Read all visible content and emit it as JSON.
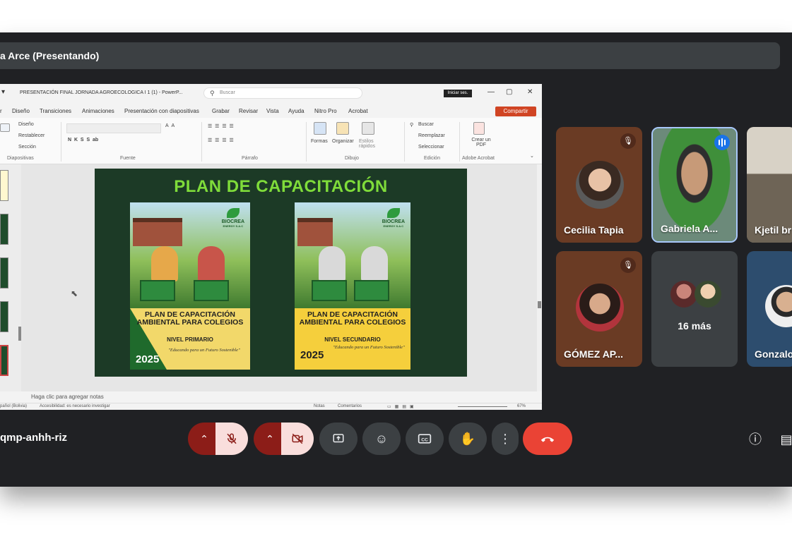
{
  "meeting": {
    "presenter_title": "a Arce (Presentando)",
    "meeting_code": "qmp-anhh-riz"
  },
  "ppt": {
    "filename": "PRESENTACIÓN FINAL JORNADA AGROECOLOGICA I 1 (1) - PowerP...",
    "search_placeholder": "Buscar",
    "account": "Iniciar ses.",
    "menu": [
      "Diseño",
      "Transiciones",
      "Animaciones",
      "Presentación con diapositivas",
      "Grabar",
      "Revisar",
      "Vista",
      "Ayuda",
      "Nitro Pro",
      "Acrobat"
    ],
    "share_label": "Compartir",
    "ribbon": {
      "slides_items": [
        "Diseño",
        "Restablecer",
        "Sección"
      ],
      "slides_group": "Diapositivas",
      "font_group": "Fuente",
      "paragraph_group": "Párrafo",
      "drawing_group": "Dibujo",
      "drawing_items": [
        "Formas",
        "Organizar",
        "Estilos rápidos"
      ],
      "editing_group": "Edición",
      "editing_items": [
        "Buscar",
        "Reemplazar",
        "Seleccionar"
      ],
      "acrobat_group": "Adobe Acrobat",
      "acrobat_item": "Crear un PDF"
    },
    "slide": {
      "title": "PLAN DE CAPACITACIÓN",
      "covers": [
        {
          "brand": "BIOCREA",
          "brand_sub": "ENERGY S.A.C",
          "heading": "PLAN DE CAPACITACIÓN AMBIENTAL PARA COLEGIOS",
          "level": "NIVEL PRIMARIO",
          "tagline": "\"Educando para un Futuro Sostenible\"",
          "year": "2025"
        },
        {
          "brand": "BIOCREA",
          "brand_sub": "ENERGY S.A.C",
          "heading": "PLAN DE CAPACITACIÓN AMBIENTAL PARA COLEGIOS",
          "level": "NIVEL SECUNDARIO",
          "tagline": "\"Educando para un Futuro Sostenible\"",
          "year": "2025"
        }
      ]
    },
    "notes_placeholder": "Haga clic para agregar notas",
    "status": {
      "language": "pañol (Bolivia)",
      "accessibility": "Accesibilidad: es necesario investigar",
      "notes": "Notas",
      "comments": "Comentarios",
      "zoom": "67%"
    }
  },
  "participants": [
    {
      "name": "Cecilia Tapia",
      "muted": true
    },
    {
      "name": "Gabriela A...",
      "speaking": true
    },
    {
      "name": "Kjetil br"
    },
    {
      "name": "GÓMEZ AP...",
      "muted": true
    },
    {
      "name": "16 más"
    },
    {
      "name": "Gonzalo"
    }
  ],
  "controls": {
    "icons": [
      "mic-off-icon",
      "camera-off-icon",
      "present-icon",
      "emoji-icon",
      "captions-icon",
      "raise-hand-icon",
      "more-options-icon",
      "end-call-icon",
      "info-icon",
      "chat-icon"
    ]
  },
  "colors": {
    "meet_bg": "#202124",
    "end_call": "#ea4335",
    "mic_off": "#f9dedc",
    "slide_title": "#7fdc3a",
    "share_button": "#d04423"
  }
}
